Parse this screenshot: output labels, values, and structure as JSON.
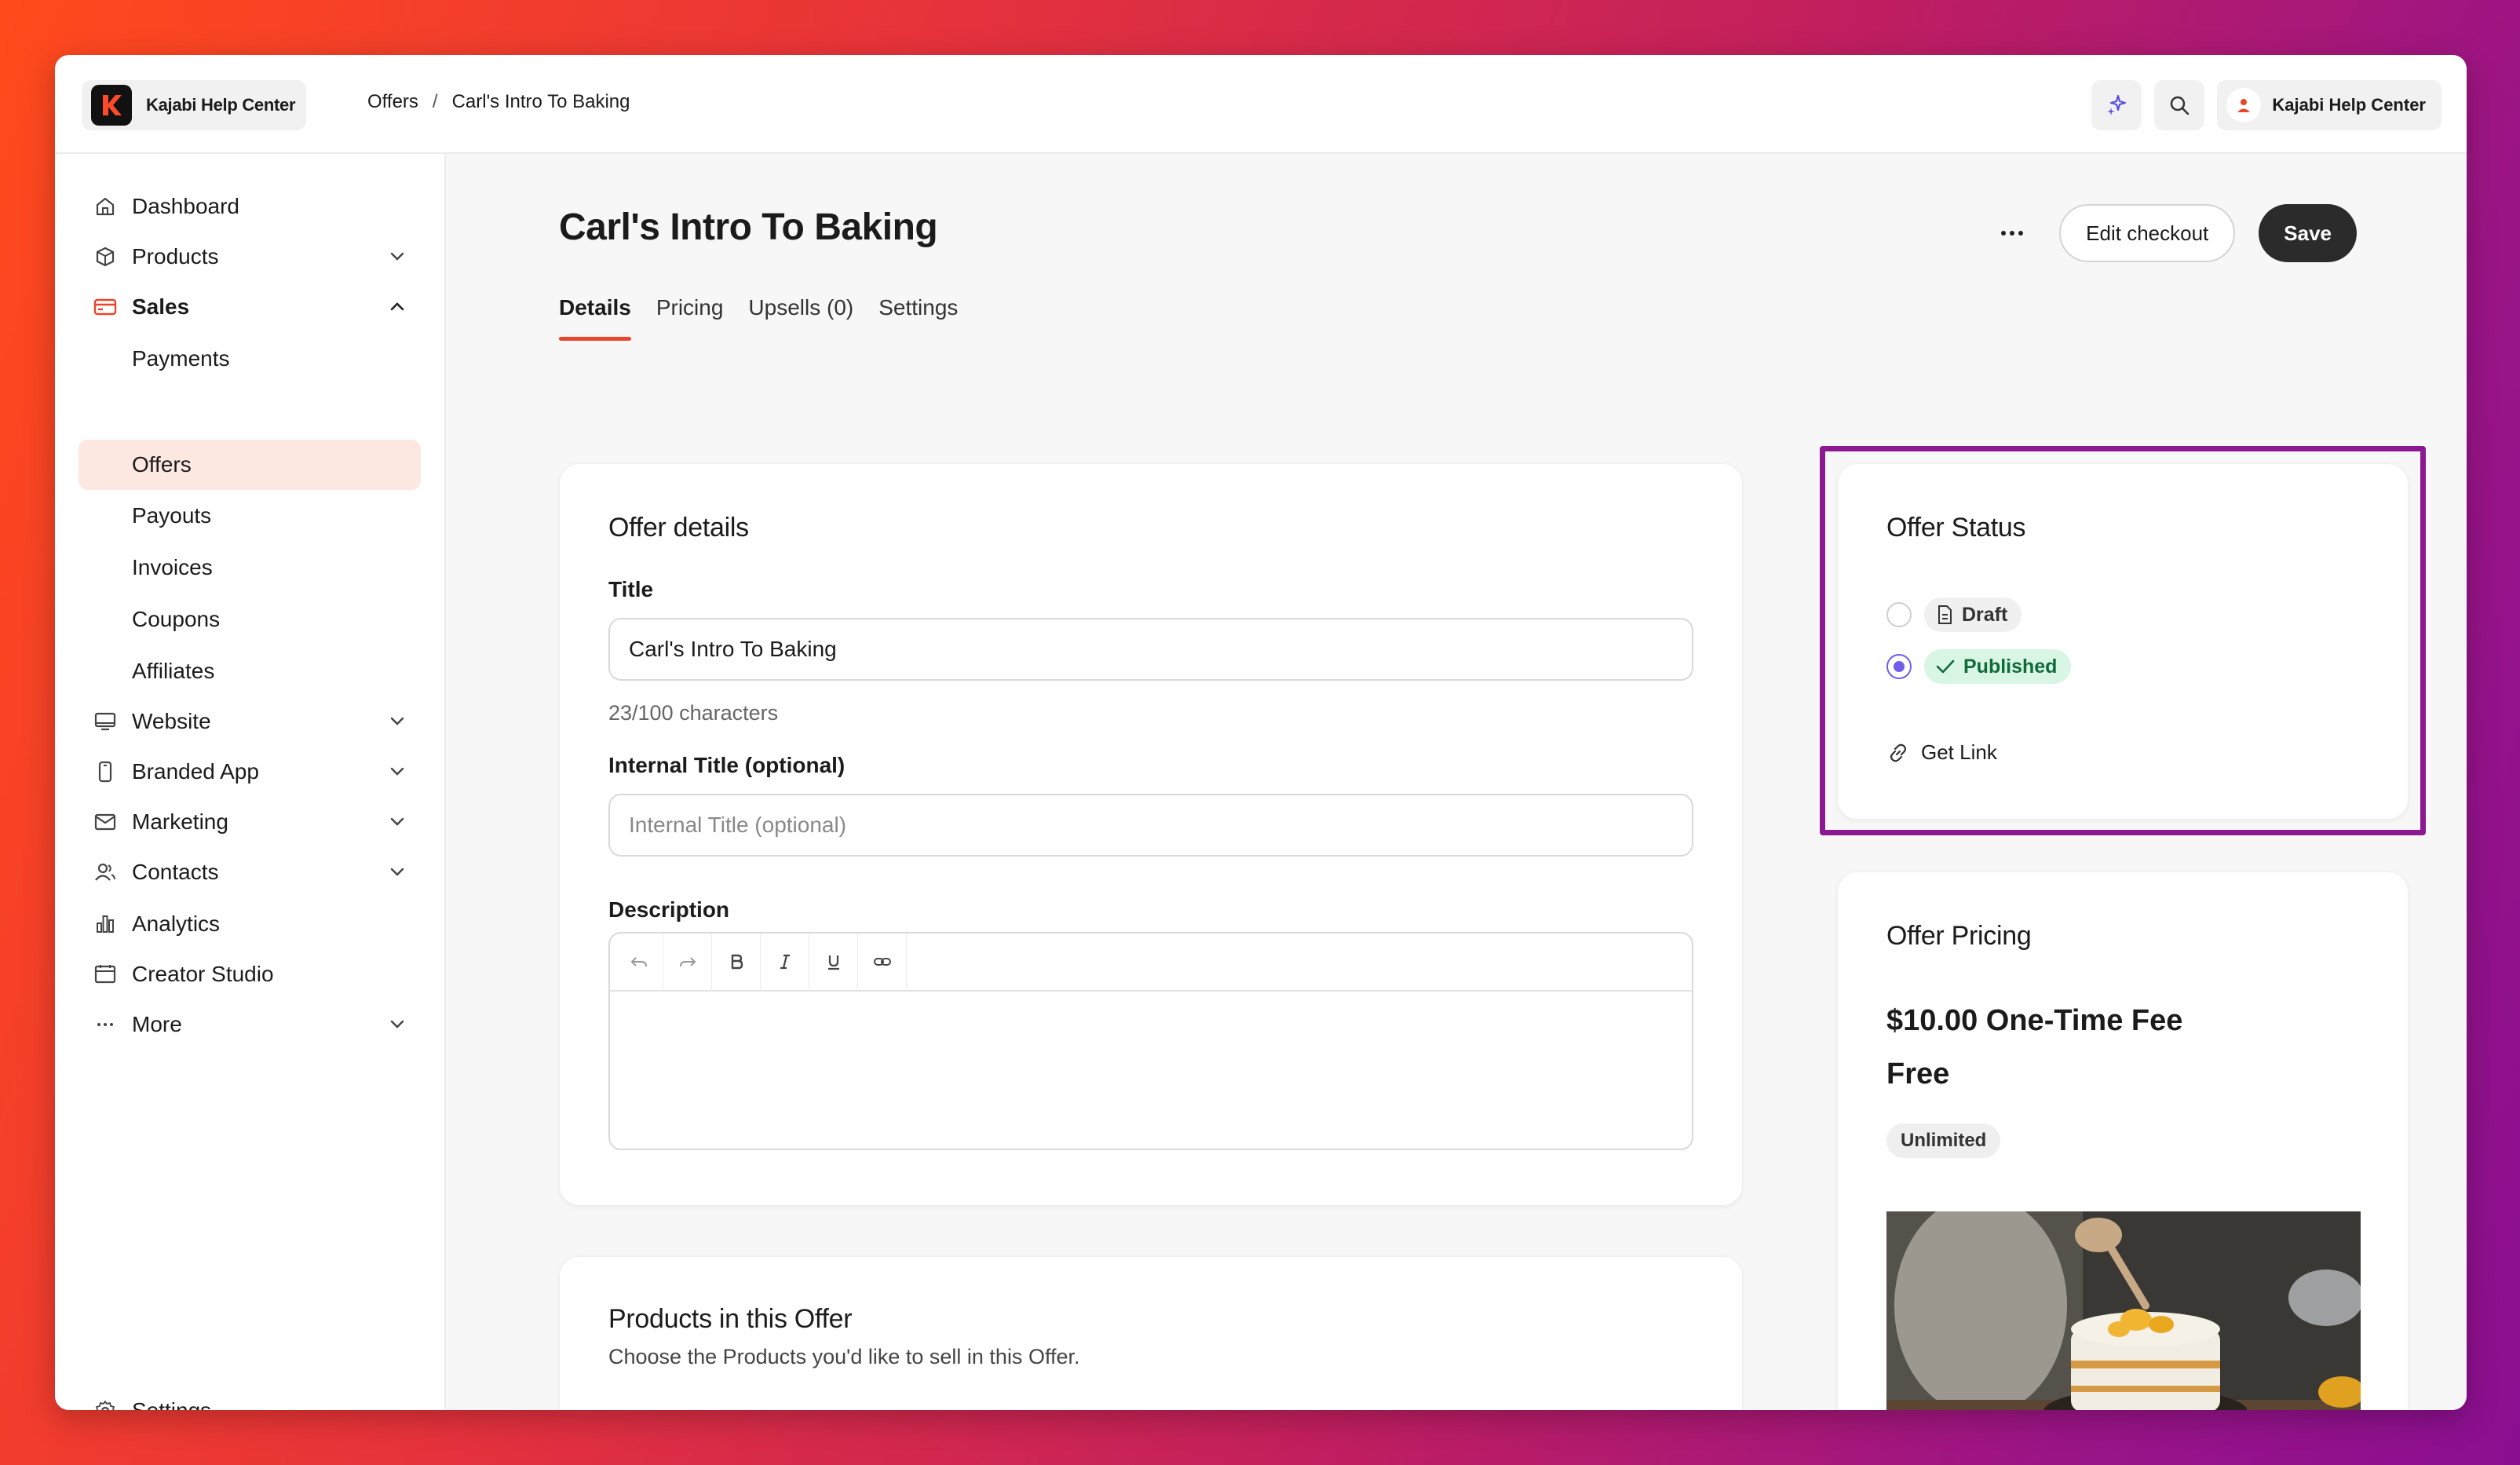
{
  "brand": {
    "name": "Kajabi Help Center"
  },
  "breadcrumb": {
    "items": [
      "Offers",
      "Carl's Intro To Baking"
    ],
    "separator": "/"
  },
  "account": {
    "name": "Kajabi Help Center"
  },
  "sidebar": {
    "items": [
      {
        "label": "Dashboard",
        "icon": "home-icon"
      },
      {
        "label": "Products",
        "icon": "box-icon"
      },
      {
        "label": "Sales",
        "icon": "credit-card-icon"
      },
      {
        "label": "Payments"
      },
      {
        "label": "Offers"
      },
      {
        "label": "Payouts"
      },
      {
        "label": "Invoices"
      },
      {
        "label": "Coupons"
      },
      {
        "label": "Affiliates"
      },
      {
        "label": "Website",
        "icon": "monitor-icon"
      },
      {
        "label": "Branded App",
        "icon": "phone-icon"
      },
      {
        "label": "Marketing",
        "icon": "mail-icon"
      },
      {
        "label": "Contacts",
        "icon": "users-icon"
      },
      {
        "label": "Analytics",
        "icon": "chart-icon"
      },
      {
        "label": "Creator Studio",
        "icon": "calendar-icon"
      },
      {
        "label": "More",
        "icon": "dots-icon"
      }
    ],
    "settings": "Settings"
  },
  "page": {
    "title": "Carl's Intro To Baking",
    "more": "···",
    "edit_checkout": "Edit checkout",
    "save": "Save",
    "tabs": [
      "Details",
      "Pricing",
      "Upsells (0)",
      "Settings"
    ]
  },
  "offer_details": {
    "heading": "Offer details",
    "title_label": "Title",
    "title_value": "Carl's Intro To Baking",
    "char_count": "23/100 characters",
    "internal_label": "Internal Title (optional)",
    "internal_placeholder": "Internal Title (optional)",
    "description_label": "Description"
  },
  "products_card": {
    "heading": "Products in this Offer",
    "subtitle": "Choose the Products you'd like to sell in this Offer."
  },
  "offer_status": {
    "heading": "Offer Status",
    "draft": "Draft",
    "published": "Published",
    "get_link": "Get Link"
  },
  "offer_pricing": {
    "heading": "Offer Pricing",
    "price": "$10.00 One-Time Fee",
    "free": "Free",
    "badge": "Unlimited"
  },
  "colors": {
    "accent": "#e8452c",
    "radio_selected": "#6f5ee8",
    "published_bg": "#d9f5e4",
    "highlight": "#8b1a92"
  }
}
